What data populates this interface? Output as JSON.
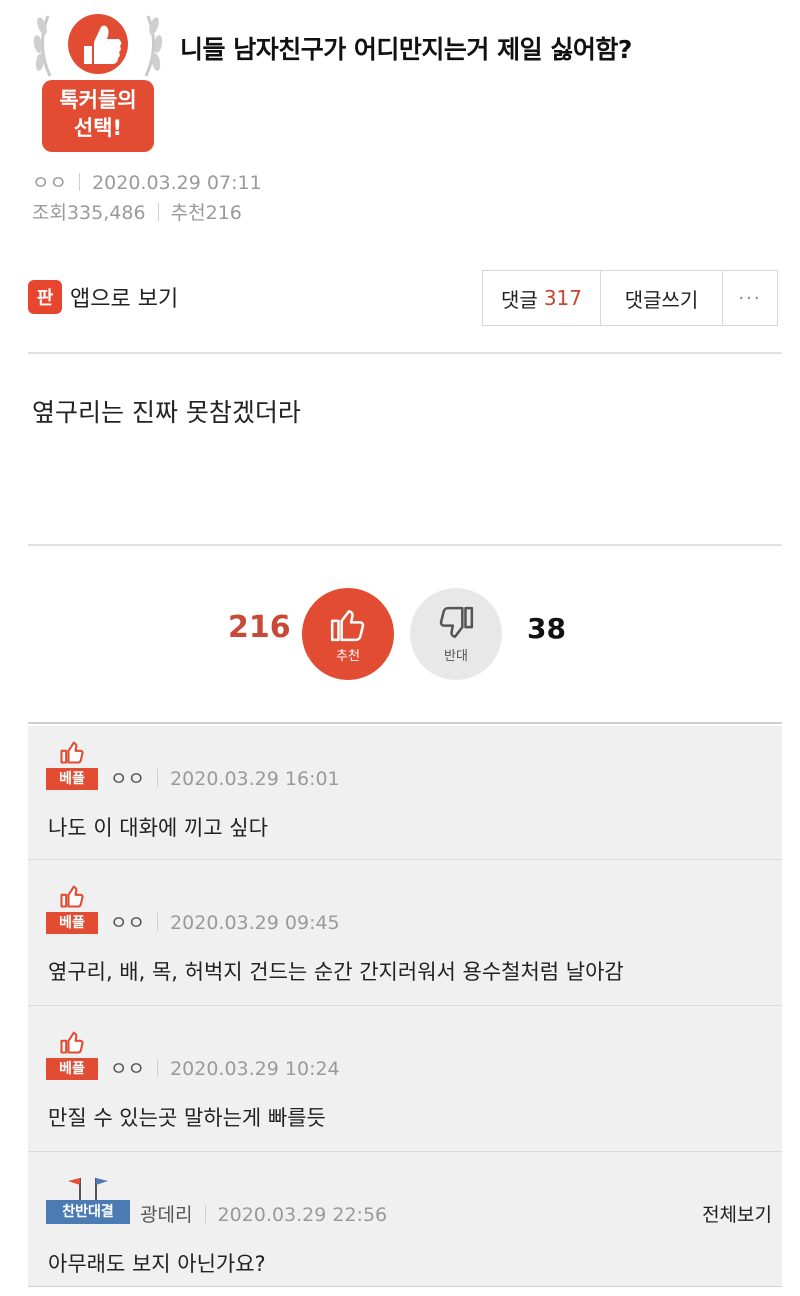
{
  "post": {
    "badge_line1": "톡커들의",
    "badge_line2": "선택!",
    "title": "니들 남자친구가 어디만지는거 제일 싫어함?",
    "author": "ㅇㅇ",
    "datetime": "2020.03.29 07:11",
    "views_label": "조회",
    "views": "335,486",
    "recommend_label": "추천",
    "recommend": "216",
    "content": "옆구리는 진짜 못참겠더라"
  },
  "toolbar": {
    "app_icon_text": "판",
    "app_label": "앱으로 보기",
    "comments_label": "댓글",
    "comments_count": "317",
    "write_comment_label": "댓글쓰기",
    "more_label": "···"
  },
  "votes": {
    "up_count": "216",
    "up_label": "추천",
    "down_label": "반대",
    "down_count": "38"
  },
  "comments": [
    {
      "badge": "베플",
      "author": "ㅇㅇ",
      "datetime": "2020.03.29 16:01",
      "text": "나도 이 대화에 끼고 싶다"
    },
    {
      "badge": "베플",
      "author": "ㅇㅇ",
      "datetime": "2020.03.29 09:45",
      "text": "옆구리, 배, 목, 허벅지 건드는 순간 간지러워서 용수철처럼 날아감"
    },
    {
      "badge": "베플",
      "author": "ㅇㅇ",
      "datetime": "2020.03.29 10:24",
      "text": "만질 수 있는곳 말하는게 빠를듯"
    },
    {
      "badge": "찬반대결",
      "author": "광데리",
      "datetime": "2020.03.29 22:56",
      "text": "아무래도 보지 아닌가요?",
      "view_all": "전체보기"
    }
  ],
  "colors": {
    "accent_red": "#e24c33",
    "count_red": "#c94533",
    "vs_blue": "#4c7bb4"
  }
}
